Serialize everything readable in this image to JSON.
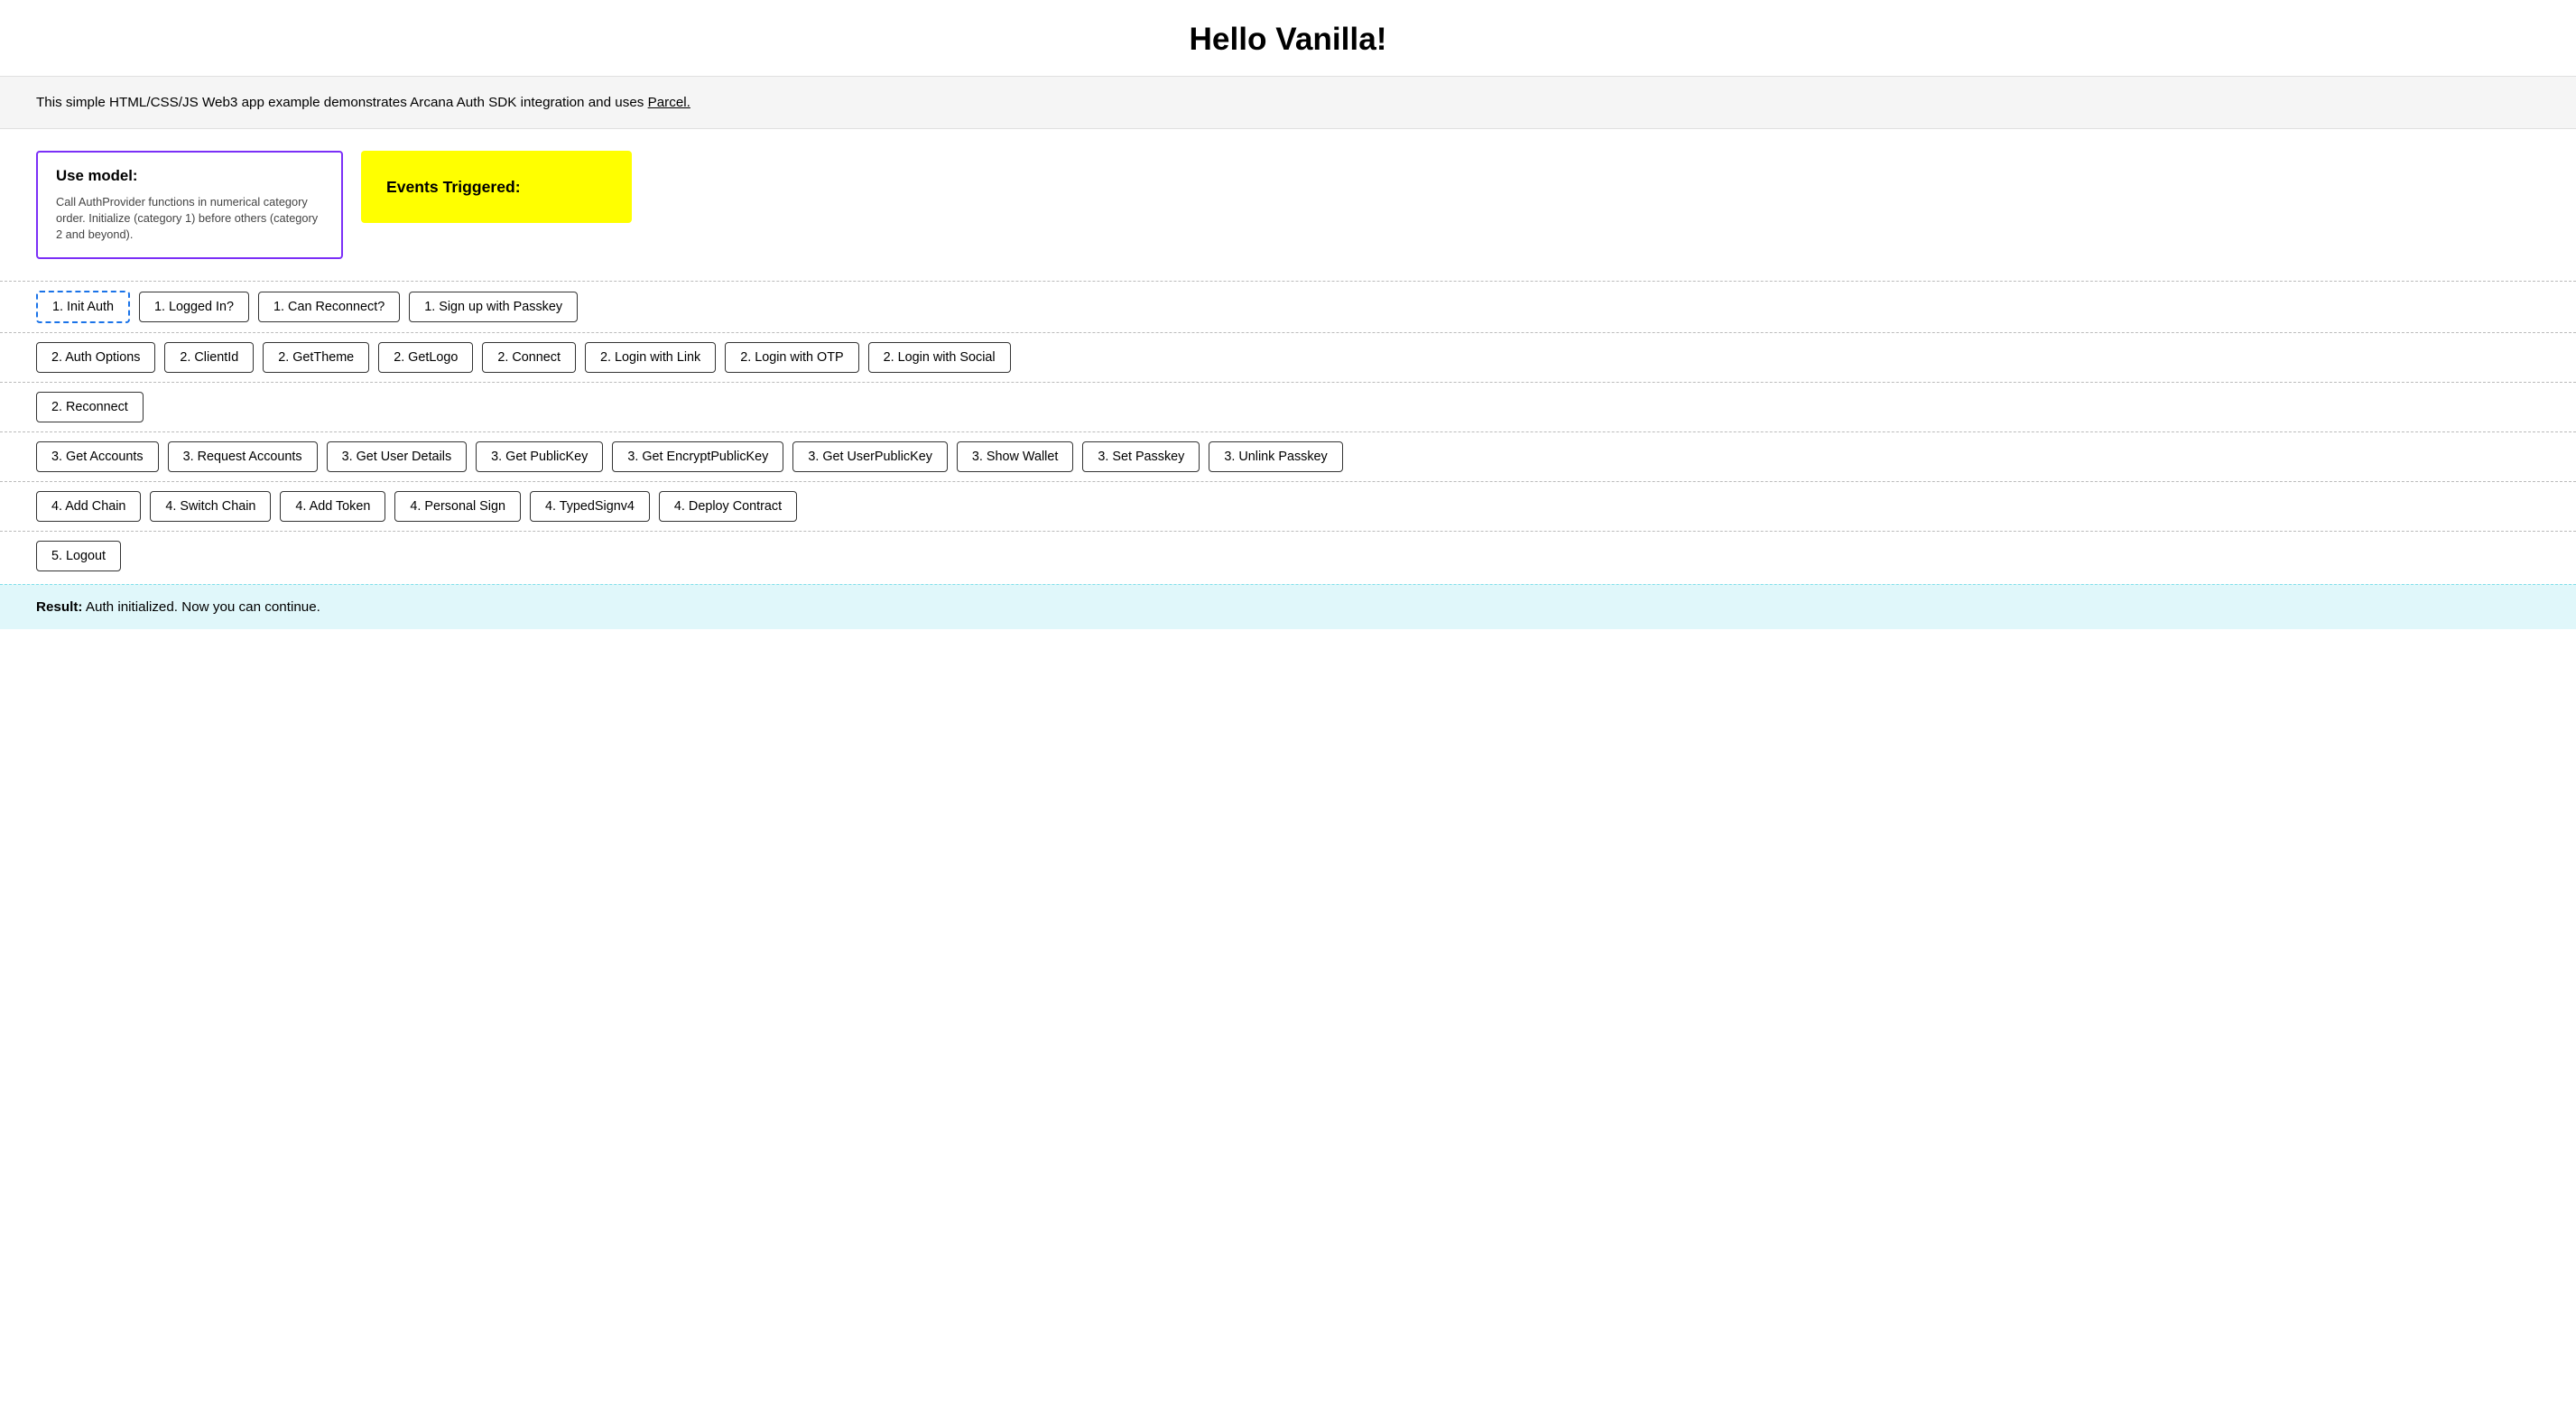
{
  "page": {
    "title": "Hello Vanilla!",
    "info_text": "This simple HTML/CSS/JS Web3 app example demonstrates Arcana Auth SDK integration and uses",
    "info_link_text": "Parcel.",
    "info_link_url": "#"
  },
  "use_model": {
    "title": "Use model:",
    "description": "Call AuthProvider functions in numerical category order. Initialize (category 1) before others (category 2 and beyond)."
  },
  "events": {
    "title": "Events Triggered:"
  },
  "sections": {
    "section1": {
      "buttons": [
        {
          "label": "1. Init Auth",
          "active": true
        },
        {
          "label": "1. Logged In?",
          "active": false
        },
        {
          "label": "1. Can Reconnect?",
          "active": false
        },
        {
          "label": "1. Sign up with Passkey",
          "active": false
        }
      ]
    },
    "section2a": {
      "buttons": [
        {
          "label": "2. Auth Options"
        },
        {
          "label": "2. ClientId"
        },
        {
          "label": "2. GetTheme"
        },
        {
          "label": "2. GetLogo"
        },
        {
          "label": "2. Connect"
        },
        {
          "label": "2. Login with Link"
        },
        {
          "label": "2. Login with OTP"
        },
        {
          "label": "2. Login with Social"
        }
      ]
    },
    "section2b": {
      "buttons": [
        {
          "label": "2. Reconnect"
        }
      ]
    },
    "section3": {
      "buttons": [
        {
          "label": "3. Get Accounts"
        },
        {
          "label": "3. Request Accounts"
        },
        {
          "label": "3. Get User Details"
        },
        {
          "label": "3. Get PublicKey"
        },
        {
          "label": "3. Get EncryptPublicKey"
        },
        {
          "label": "3. Get UserPublicKey"
        },
        {
          "label": "3. Show Wallet"
        },
        {
          "label": "3. Set Passkey"
        },
        {
          "label": "3. Unlink Passkey"
        }
      ]
    },
    "section4": {
      "buttons": [
        {
          "label": "4. Add Chain"
        },
        {
          "label": "4. Switch Chain"
        },
        {
          "label": "4. Add Token"
        },
        {
          "label": "4. Personal Sign"
        },
        {
          "label": "4. TypedSignv4"
        },
        {
          "label": "4. Deploy Contract"
        }
      ]
    },
    "section5": {
      "buttons": [
        {
          "label": "5. Logout"
        }
      ]
    }
  },
  "result": {
    "label": "Result:",
    "text": "Auth initialized. Now you can continue."
  }
}
